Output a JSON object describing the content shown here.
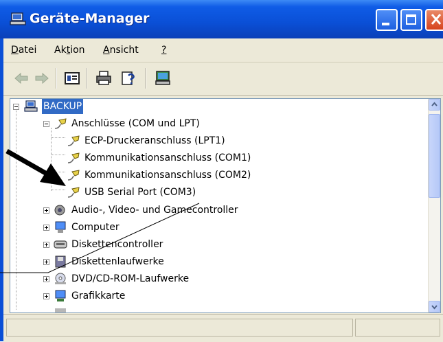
{
  "window": {
    "title": "Geräte-Manager"
  },
  "menu": {
    "items": [
      {
        "label": "Datei",
        "mnemonic": "D"
      },
      {
        "label": "Aktion",
        "mnemonic": "t"
      },
      {
        "label": "Ansicht",
        "mnemonic": "A"
      },
      {
        "label": "?",
        "mnemonic": "?"
      }
    ]
  },
  "toolbar": {
    "icons": [
      "back-arrow-icon",
      "forward-arrow-icon",
      "properties-icon",
      "print-icon",
      "help-icon",
      "scan-hardware-icon"
    ]
  },
  "tree": {
    "root": {
      "label": "BACKUP",
      "icon": "computer-icon",
      "selected": true
    },
    "ports_category": {
      "label": "Anschlüsse (COM und LPT)",
      "icon": "port-connector-icon",
      "expanded": true
    },
    "ports": [
      {
        "label": "ECP-Druckeranschluss (LPT1)",
        "icon": "port-connector-icon"
      },
      {
        "label": "Kommunikationsanschluss (COM1)",
        "icon": "port-connector-icon"
      },
      {
        "label": "Kommunikationsanschluss (COM2)",
        "icon": "port-connector-icon"
      },
      {
        "label": "USB Serial Port (COM3)",
        "icon": "port-connector-icon"
      }
    ],
    "categories": [
      {
        "label": "Audio-, Video- und Gamecontroller",
        "icon": "speaker-icon"
      },
      {
        "label": "Computer",
        "icon": "monitor-icon"
      },
      {
        "label": "Diskettencontroller",
        "icon": "controller-icon"
      },
      {
        "label": "Diskettenlaufwerke",
        "icon": "floppy-drive-icon"
      },
      {
        "label": "DVD/CD-ROM-Laufwerke",
        "icon": "cd-drive-icon"
      },
      {
        "label": "Grafikkarte",
        "icon": "display-adapter-icon"
      }
    ]
  },
  "colors": {
    "titlebar": "#0a4fd6",
    "selection": "#316ac5",
    "chrome": "#ece9d8"
  }
}
